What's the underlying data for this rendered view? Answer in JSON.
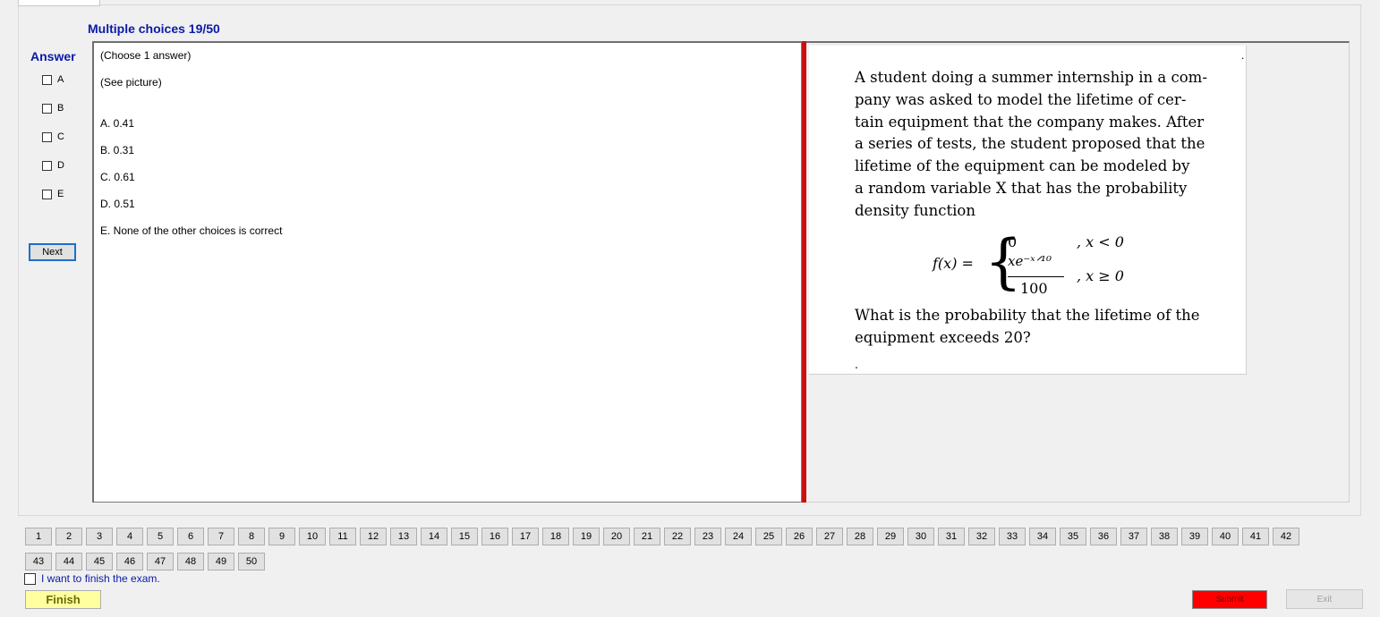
{
  "header": {
    "title": "Multiple choices 19/50"
  },
  "answer": {
    "label": "Answer",
    "options": [
      {
        "letter": "A",
        "checked": false
      },
      {
        "letter": "B",
        "checked": false
      },
      {
        "letter": "C",
        "checked": false
      },
      {
        "letter": "D",
        "checked": false
      },
      {
        "letter": "E",
        "checked": false
      }
    ],
    "next_label": "Next"
  },
  "question": {
    "instruction": "(Choose 1 answer)",
    "note": "(See picture)",
    "choices": [
      "A.  0.41",
      "B.  0.31",
      "C.  0.61",
      "D.  0.51",
      "E.  None of the other choices is correct"
    ]
  },
  "picture": {
    "paragraph_lines": [
      "A student doing a summer internship in a com-",
      "pany was asked to model the lifetime of cer-",
      "tain equipment that the company makes. After",
      "a series of tests, the student proposed that the",
      "lifetime of the equipment can be modeled by",
      "a random variable X that has the probability",
      "density function"
    ],
    "formula": {
      "lhs": "f(x) =",
      "case0_value": "0",
      "case0_cond": ", x < 0",
      "case1_numerator": "xe⁻ˣᐟ¹⁰",
      "case1_denominator": "100",
      "case1_cond": ", x ≥ 0"
    },
    "question_lines": [
      "What is the probability that the lifetime of the",
      "equipment exceeds 20?"
    ],
    "trailing_mark": "."
  },
  "navigation": {
    "row1": [
      "1",
      "2",
      "3",
      "4",
      "5",
      "6",
      "7",
      "8",
      "9",
      "10",
      "11",
      "12",
      "13",
      "14",
      "15",
      "16",
      "17",
      "18",
      "19",
      "20",
      "21",
      "22",
      "23",
      "24",
      "25",
      "26",
      "27",
      "28",
      "29",
      "30",
      "31",
      "32",
      "33",
      "34",
      "35",
      "36",
      "37",
      "38",
      "39",
      "40",
      "41",
      "42"
    ],
    "row2": [
      "43",
      "44",
      "45",
      "46",
      "47",
      "48",
      "49",
      "50"
    ]
  },
  "footer": {
    "finish_checkbox_label": "I want to finish the exam.",
    "finish_label": "Finish",
    "submit_label": "Submit",
    "exit_label": "Exit"
  },
  "colors": {
    "title_blue": "#0a1aa8",
    "divider_red": "#cc1010",
    "finish_yellow": "#ffffa0",
    "submit_red": "#ff0000"
  }
}
